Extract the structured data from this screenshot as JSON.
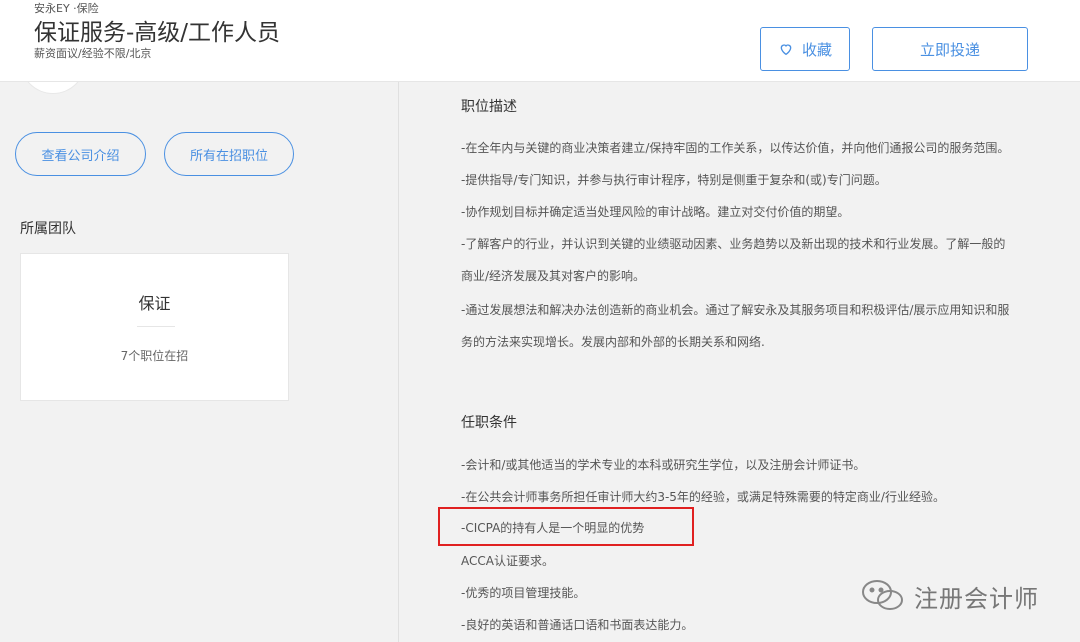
{
  "header": {
    "company": "安永EY ·保险",
    "title": "保证服务-高级/工作人员",
    "meta": "薪资面议/经验不限/北京",
    "favorite_label": "收藏",
    "apply_label": "立即投递"
  },
  "sidebar": {
    "company_intro_label": "查看公司介绍",
    "all_jobs_label": "所有在招职位",
    "team_heading": "所属团队",
    "team_name": "保证",
    "team_count": "7个职位在招"
  },
  "description": {
    "title": "职位描述",
    "lines": [
      "-在全年内与关键的商业决策者建立/保持牢固的工作关系，以传达价值，并向他们通报公司的服务范围。",
      "-提供指导/专门知识，并参与执行审计程序，特别是侧重于复杂和(或)专门问题。",
      "-协作规划目标并确定适当处理风险的审计战略。建立对交付价值的期望。",
      "-了解客户的行业，并认识到关键的业绩驱动因素、业务趋势以及新出现的技术和行业发展。了解一般的",
      "商业/经济发展及其对客户的影响。",
      "-通过发展想法和解决办法创造新的商业机会。通过了解安永及其服务项目和积极评估/展示应用知识和服",
      "务的方法来实现增长。发展内部和外部的长期关系和网络."
    ]
  },
  "requirements": {
    "title": "任职条件",
    "lines": [
      "-会计和/或其他适当的学术专业的本科或研究生学位，以及注册会计师证书。",
      "-在公共会计师事务所担任审计师大约3-5年的经验，或满足特殊需要的特定商业/行业经验。",
      "-CICPA的持有人是一个明显的优势",
      "ACCA认证要求。",
      "-优秀的项目管理技能。",
      "-良好的英语和普通话口语和书面表达能力。"
    ]
  },
  "watermark": {
    "text": "注册会计师"
  },
  "colors": {
    "accent": "#4a90e2",
    "highlight": "#e02020"
  }
}
